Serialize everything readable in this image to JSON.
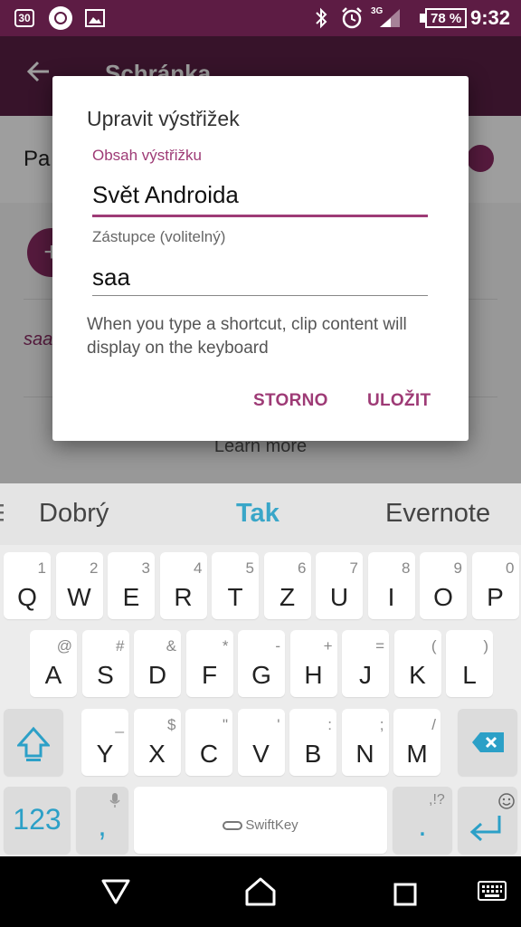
{
  "status_bar": {
    "calendar_day": "30",
    "network": "3G",
    "battery": "78 %",
    "time": "9:32"
  },
  "app": {
    "title": "Schránka",
    "row_label": "Pa",
    "clip_preview": "saa",
    "learn_more": "Learn more"
  },
  "dialog": {
    "title": "Upravit výstřižek",
    "content_label": "Obsah výstřižku",
    "content_value": "Svět Androida",
    "shortcut_label": "Zástupce (volitelný)",
    "shortcut_value": "saa",
    "help_text": "When you type a shortcut, clip content will display on the keyboard",
    "cancel_label": "STORNO",
    "save_label": "ULOŽIT"
  },
  "suggestions": [
    "Dobrý",
    "Tak",
    "Evernote"
  ],
  "keyboard": {
    "row1": [
      {
        "m": "Q",
        "h": "1"
      },
      {
        "m": "W",
        "h": "2"
      },
      {
        "m": "E",
        "h": "3"
      },
      {
        "m": "R",
        "h": "4"
      },
      {
        "m": "T",
        "h": "5"
      },
      {
        "m": "Z",
        "h": "6"
      },
      {
        "m": "U",
        "h": "7"
      },
      {
        "m": "I",
        "h": "8"
      },
      {
        "m": "O",
        "h": "9"
      },
      {
        "m": "P",
        "h": "0"
      }
    ],
    "row2": [
      {
        "m": "A",
        "h": "@"
      },
      {
        "m": "S",
        "h": "#"
      },
      {
        "m": "D",
        "h": "&"
      },
      {
        "m": "F",
        "h": "*"
      },
      {
        "m": "G",
        "h": "-"
      },
      {
        "m": "H",
        "h": "+"
      },
      {
        "m": "J",
        "h": "="
      },
      {
        "m": "K",
        "h": "("
      },
      {
        "m": "L",
        "h": ")"
      }
    ],
    "row3": [
      {
        "m": "Y",
        "h": "_"
      },
      {
        "m": "X",
        "h": "$"
      },
      {
        "m": "C",
        "h": "\""
      },
      {
        "m": "V",
        "h": "'"
      },
      {
        "m": "B",
        "h": ":"
      },
      {
        "m": "N",
        "h": ";"
      },
      {
        "m": "M",
        "h": "/"
      }
    ],
    "numbers_label": "123",
    "comma": ",",
    "space_brand": "SwiftKey",
    "period": ".",
    "punct_hint": ",!?",
    "accent_color": "#2ca0c7"
  },
  "colors": {
    "brand_dark": "#5d1c44",
    "accent": "#9e3b76"
  }
}
